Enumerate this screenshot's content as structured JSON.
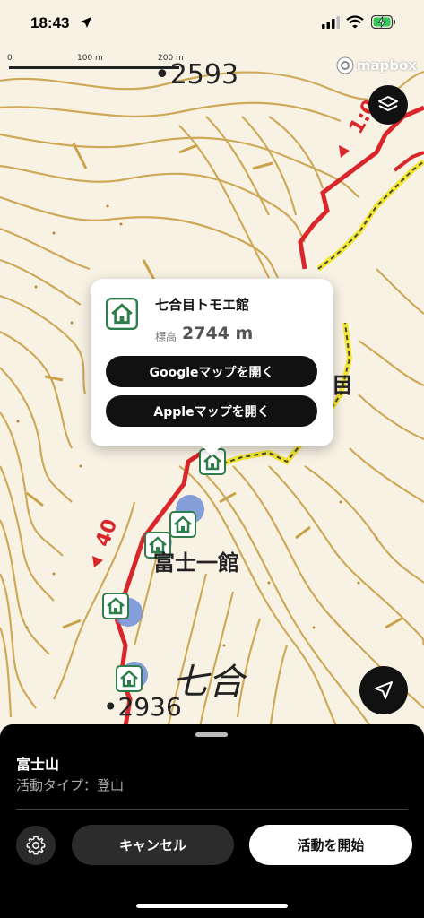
{
  "status_bar": {
    "time": "18:43"
  },
  "map": {
    "scale": {
      "zero": "0",
      "mid": "100 m",
      "end": "200 m"
    },
    "attribution": "mapbox",
    "labels": {
      "peak_2593": "•2593",
      "peak_2936": "•2936",
      "hut_fujiichi": "富士一館",
      "station_7": "七合",
      "partial_char": "目",
      "trail_time_top": "1:0",
      "trail_time_left": "40"
    },
    "colors": {
      "trail": "#d8262b",
      "alt_trail": "#f3e632",
      "contour": "#c9a24a",
      "hut_green": "#2f7d4a"
    }
  },
  "popup": {
    "title": "七合目トモエ館",
    "elevation_label": "標高",
    "elevation_value": "2744 m",
    "google_button": "Googleマップを開く",
    "apple_button": "Appleマップを開く"
  },
  "sheet": {
    "route_name": "富士山",
    "activity_type": "活動タイプ：登山",
    "cancel_button": "キャンセル",
    "start_button": "活動を開始"
  }
}
